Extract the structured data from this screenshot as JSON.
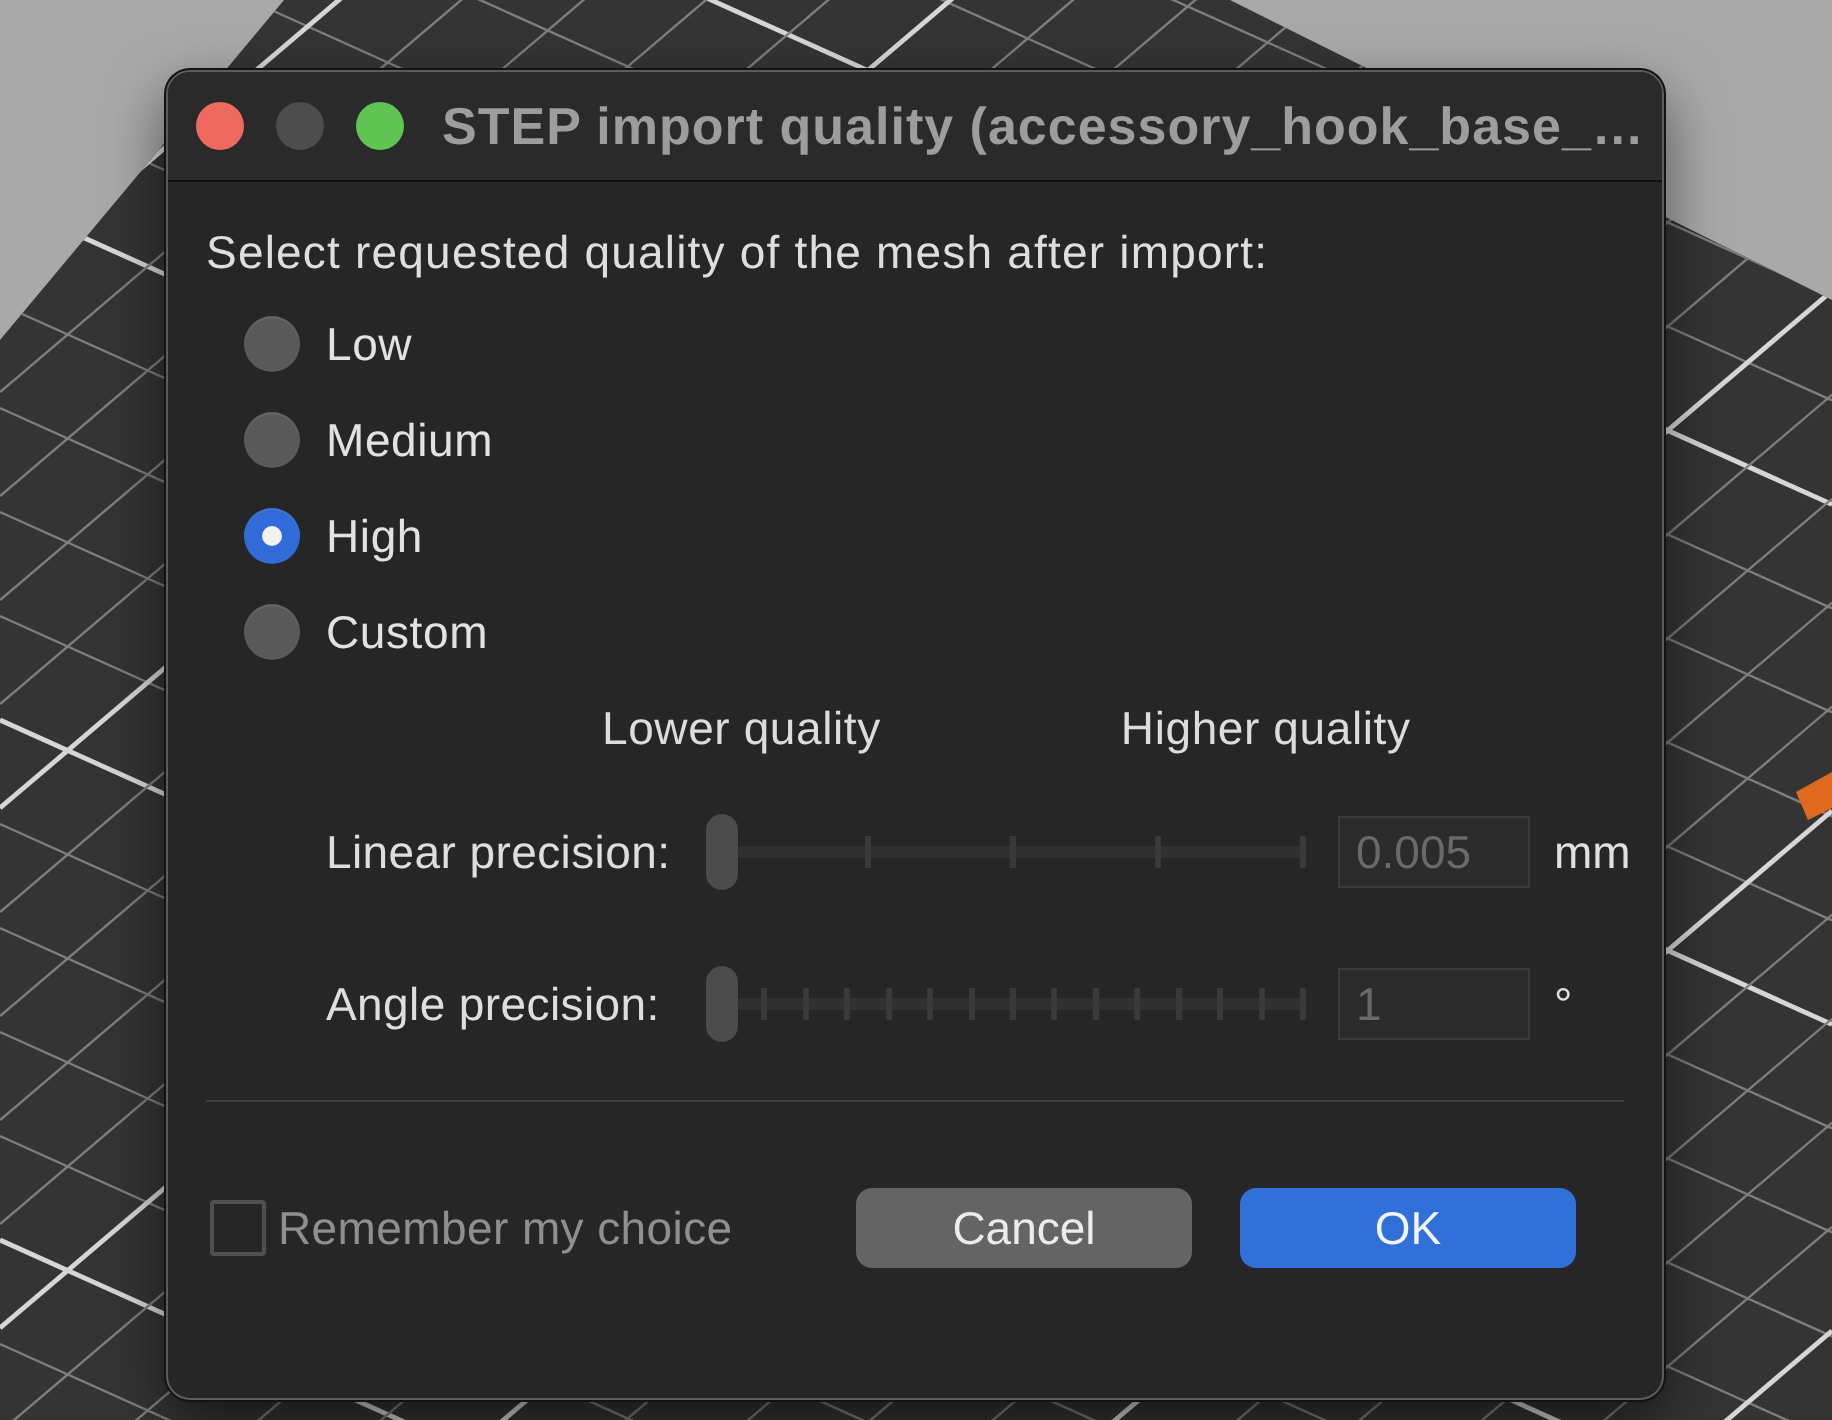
{
  "window": {
    "title": "STEP import quality (accessory_hook_base_…",
    "controls": [
      {
        "kind": "close",
        "disabled": false
      },
      {
        "kind": "minimize",
        "disabled": true
      },
      {
        "kind": "zoom",
        "disabled": false
      }
    ]
  },
  "prompt": "Select requested quality of the mesh after import:",
  "quality_options": [
    {
      "label": "Low",
      "selected": false
    },
    {
      "label": "Medium",
      "selected": false
    },
    {
      "label": "High",
      "selected": true
    },
    {
      "label": "Custom",
      "selected": false
    }
  ],
  "scale_labels": {
    "low": "Lower quality",
    "high": "Higher quality"
  },
  "precision": [
    {
      "label": "Linear precision:",
      "level": 0,
      "value": "0.005",
      "unit": "mm",
      "disabled": true
    },
    {
      "label": "Angle precision:",
      "level": 0,
      "value": "1",
      "unit": "°",
      "disabled": true
    }
  ],
  "remember": {
    "label": "Remember my choice",
    "checked": false
  },
  "buttons": [
    {
      "label": "Cancel",
      "kind": "secondary"
    },
    {
      "label": "OK",
      "kind": "primary"
    }
  ]
}
